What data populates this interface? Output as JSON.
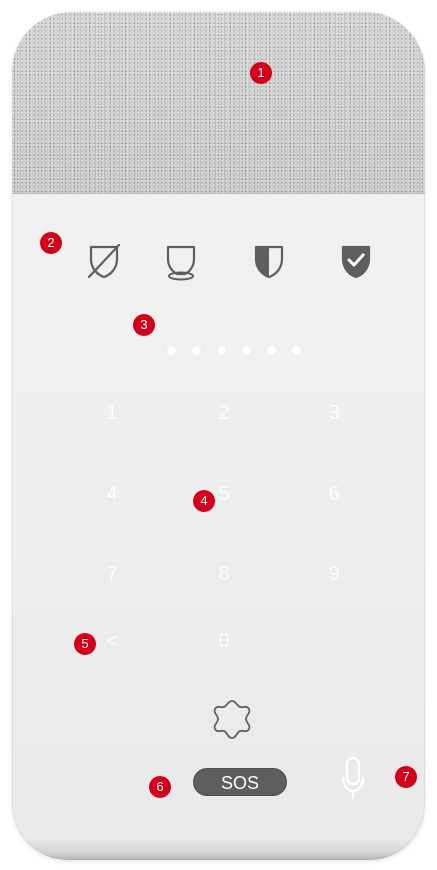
{
  "markers": [
    "1",
    "2",
    "3",
    "4",
    "5",
    "6",
    "7"
  ],
  "status_icons": [
    "disarmed-shield-icon",
    "partial-shield-icon",
    "half-shield-icon",
    "armed-shield-check-icon"
  ],
  "pin_length": 6,
  "keypad": {
    "keys": [
      "1",
      "2",
      "3",
      "4",
      "5",
      "6",
      "7",
      "8",
      "9",
      "<",
      "0"
    ]
  },
  "sos_label": "SOS",
  "colors": {
    "marker": "#d4001a",
    "icon": "#5e5e5e",
    "sos_background": "#5e5e5e",
    "key_text": "#ffffff"
  }
}
